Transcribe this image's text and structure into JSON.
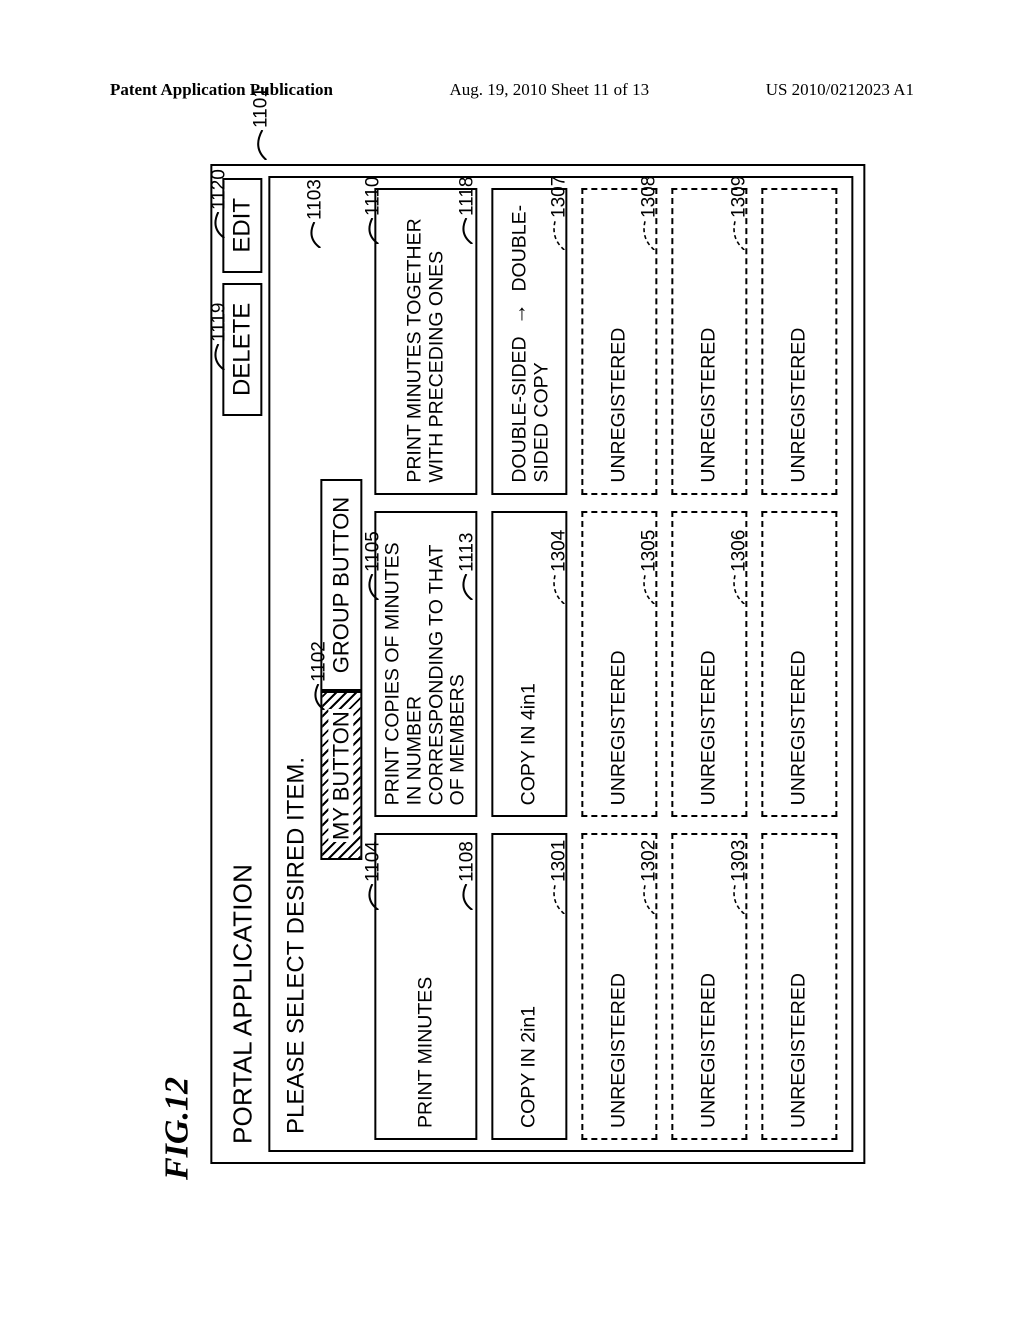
{
  "header": {
    "left": "Patent Application Publication",
    "center": "Aug. 19, 2010  Sheet 11 of 13",
    "right": "US 2010/0212023 A1"
  },
  "figure_label": "FIG.12",
  "screen": {
    "title": "PORTAL APPLICATION",
    "buttons": {
      "delete": "DELETE",
      "edit": "EDIT"
    },
    "instruction": "PLEASE SELECT DESIRED ITEM.",
    "tabs": {
      "my": "MY BUTTON",
      "group": "GROUP BUTTON"
    }
  },
  "cells": {
    "r1c1": "PRINT MINUTES",
    "r1c2": "PRINT COPIES OF MINUTES IN NUMBER CORRESPONDING TO THAT OF MEMBERS",
    "r1c3": "PRINT MINUTES TOGETHER WITH PRECEDING ONES",
    "r2c1": "COPY IN 2in1",
    "r2c2": "COPY IN 4in1",
    "r2c3a": "DOUBLE-SIDED",
    "r2c3b": "DOUBLE-SIDED COPY",
    "unreg": "UNREGISTERED"
  },
  "callouts": {
    "c1101": "1101",
    "c1102": "1102",
    "c1103": "1103",
    "c1104": "1104",
    "c1105": "1105",
    "c1108": "1108",
    "c1110": "1110",
    "c1113": "1113",
    "c1118": "1118",
    "c1119": "1119",
    "c1120": "1120",
    "c1301": "1301",
    "c1302": "1302",
    "c1303": "1303",
    "c1304": "1304",
    "c1305": "1305",
    "c1306": "1306",
    "c1307": "1307",
    "c1308": "1308",
    "c1309": "1309"
  }
}
